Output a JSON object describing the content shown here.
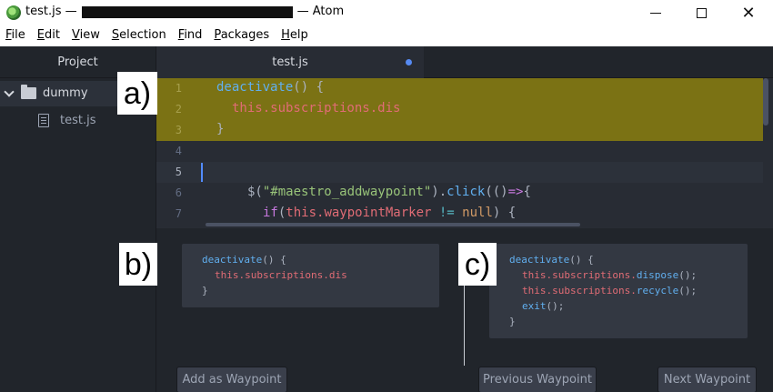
{
  "window": {
    "title_prefix": "test.js —",
    "title_suffix": "— Atom",
    "controls": {
      "minimize": "—",
      "maximize": "☐",
      "close": "✕"
    }
  },
  "menu": [
    {
      "label": "File",
      "underline": "F",
      "rest": "ile"
    },
    {
      "label": "Edit",
      "underline": "E",
      "rest": "dit"
    },
    {
      "label": "View",
      "underline": "V",
      "rest": "iew"
    },
    {
      "label": "Selection",
      "underline": "S",
      "rest": "election"
    },
    {
      "label": "Find",
      "underline": "F",
      "rest": "ind"
    },
    {
      "label": "Packages",
      "underline": "P",
      "rest": "ackages"
    },
    {
      "label": "Help",
      "underline": "H",
      "rest": "elp"
    }
  ],
  "tree": {
    "header": "Project",
    "folder": "dummy",
    "file": "test.js"
  },
  "tab": {
    "label": "test.js"
  },
  "editor": {
    "line_numbers": [
      "1",
      "2",
      "3",
      "4",
      "5",
      "6",
      "7"
    ],
    "lines": {
      "l1_fn": "deactivate",
      "l1_rest": "() {",
      "l2_this": "this",
      "l2_rest": ".subscriptions.dis",
      "l3": "}",
      "l6_a": "$(",
      "l6_str": "\"#maestro_addwaypoint\"",
      "l6_b": ").",
      "l6_click": "click",
      "l6_c": "((",
      "l6_d": ")",
      "l6_arrow": "=>",
      "l6_e": "{",
      "l7_if": "if",
      "l7_a": "(",
      "l7_this": "this",
      "l7_b": ".waypointMarker ",
      "l7_op": "!=",
      "l7_c": " ",
      "l7_null": "null",
      "l7_d": ") {"
    }
  },
  "snippet_b": {
    "line1_fn": "deactivate",
    "line1_rest": "() {",
    "line2": "this.subscriptions.dis",
    "line3": "}"
  },
  "snippet_c": {
    "line1_fn": "deactivate",
    "line1_rest": "() {",
    "line2_this": "this.subscriptions.",
    "line2_fn": "dispose",
    "line2_rest": "();",
    "line3_this": "this.subscriptions.",
    "line3_fn": "recycle",
    "line3_rest": "();",
    "line4_fn": "exit",
    "line4_rest": "();",
    "line5": "}"
  },
  "buttons": {
    "add": "Add as Waypoint",
    "previous": "Previous Waypoint",
    "next": "Next Waypoint"
  },
  "figure_labels": {
    "a": "a)",
    "b": "b)",
    "c": "c)"
  },
  "colors": {
    "highlight": "#7b7214",
    "editor_bg": "#282c34",
    "panel_bg": "#21252b",
    "accent_blue": "#568af2"
  }
}
